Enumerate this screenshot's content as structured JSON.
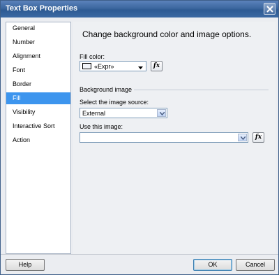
{
  "window": {
    "title": "Text Box Properties"
  },
  "nav": {
    "items": [
      {
        "label": "General"
      },
      {
        "label": "Number"
      },
      {
        "label": "Alignment"
      },
      {
        "label": "Font"
      },
      {
        "label": "Border"
      },
      {
        "label": "Fill",
        "selected": true
      },
      {
        "label": "Visibility"
      },
      {
        "label": "Interactive Sort"
      },
      {
        "label": "Action"
      }
    ]
  },
  "content": {
    "heading": "Change background color and image options.",
    "fill_color": {
      "label": "Fill color:",
      "value": "«Expr»",
      "swatch": "#f2f4f8"
    },
    "background_image": {
      "group_label": "Background image",
      "source_label": "Select the image source:",
      "source_value": "External",
      "image_label": "Use this image:",
      "image_value": ""
    },
    "fx_label": "fx"
  },
  "buttons": {
    "help": "Help",
    "ok": "OK",
    "cancel": "Cancel"
  },
  "colors": {
    "titlebar": "#2d5a93",
    "selected": "#3d95ee"
  }
}
